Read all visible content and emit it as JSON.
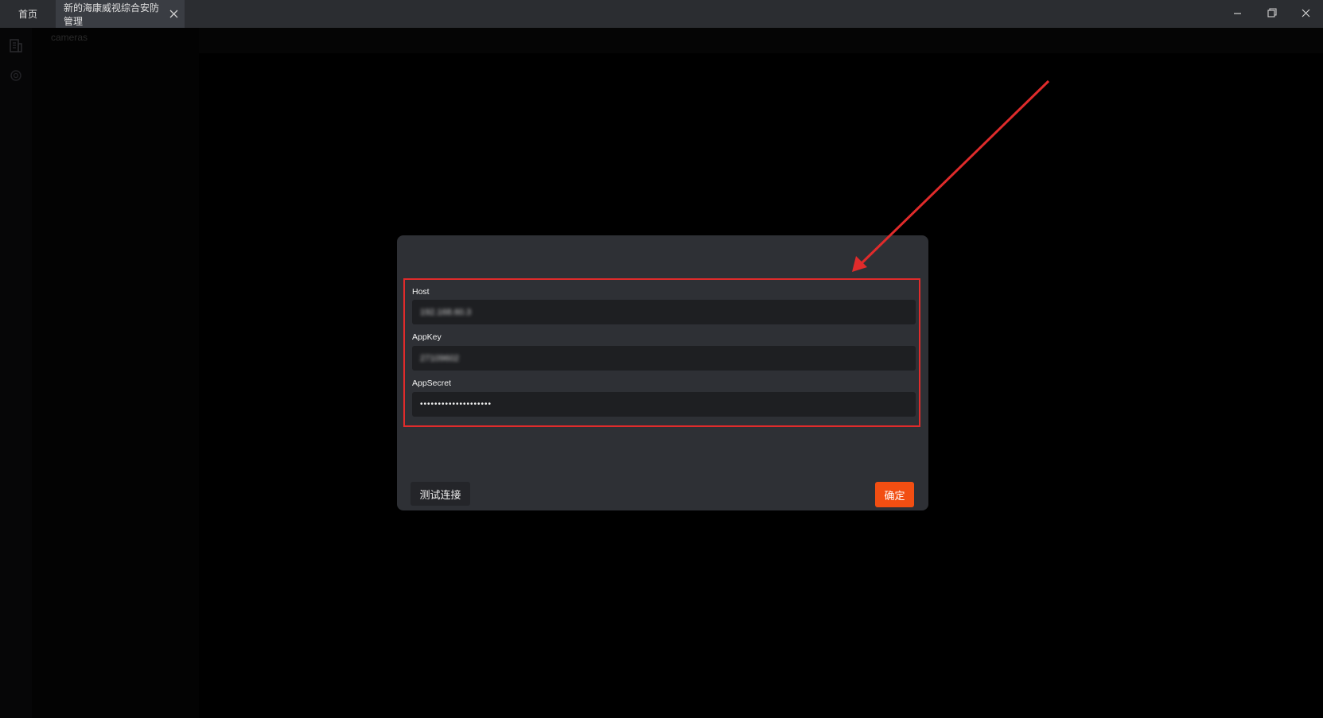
{
  "titlebar": {
    "tabs": [
      {
        "label": "首页"
      },
      {
        "label": "新的海康威视综合安防管理"
      }
    ]
  },
  "background": {
    "breadcrumb": "cameras"
  },
  "modal": {
    "fields": [
      {
        "label": "Host",
        "value": "192.168.60.3"
      },
      {
        "label": "AppKey",
        "value": "27109602"
      },
      {
        "label": "AppSecret",
        "value": "••••••••••••••••••••"
      }
    ],
    "test_button": "测试连接",
    "confirm_button": "确定"
  },
  "colors": {
    "titlebar_bg": "#2b2d31",
    "modal_bg": "#2e3035",
    "input_bg": "#1e1f22",
    "highlight": "#e02b2b",
    "accent": "#f24e12"
  },
  "icons": {
    "sidebar": [
      "building-icon",
      "gear-icon"
    ],
    "tab_close": "close-icon",
    "window": [
      "minimize-icon",
      "restore-icon",
      "close-icon"
    ]
  }
}
